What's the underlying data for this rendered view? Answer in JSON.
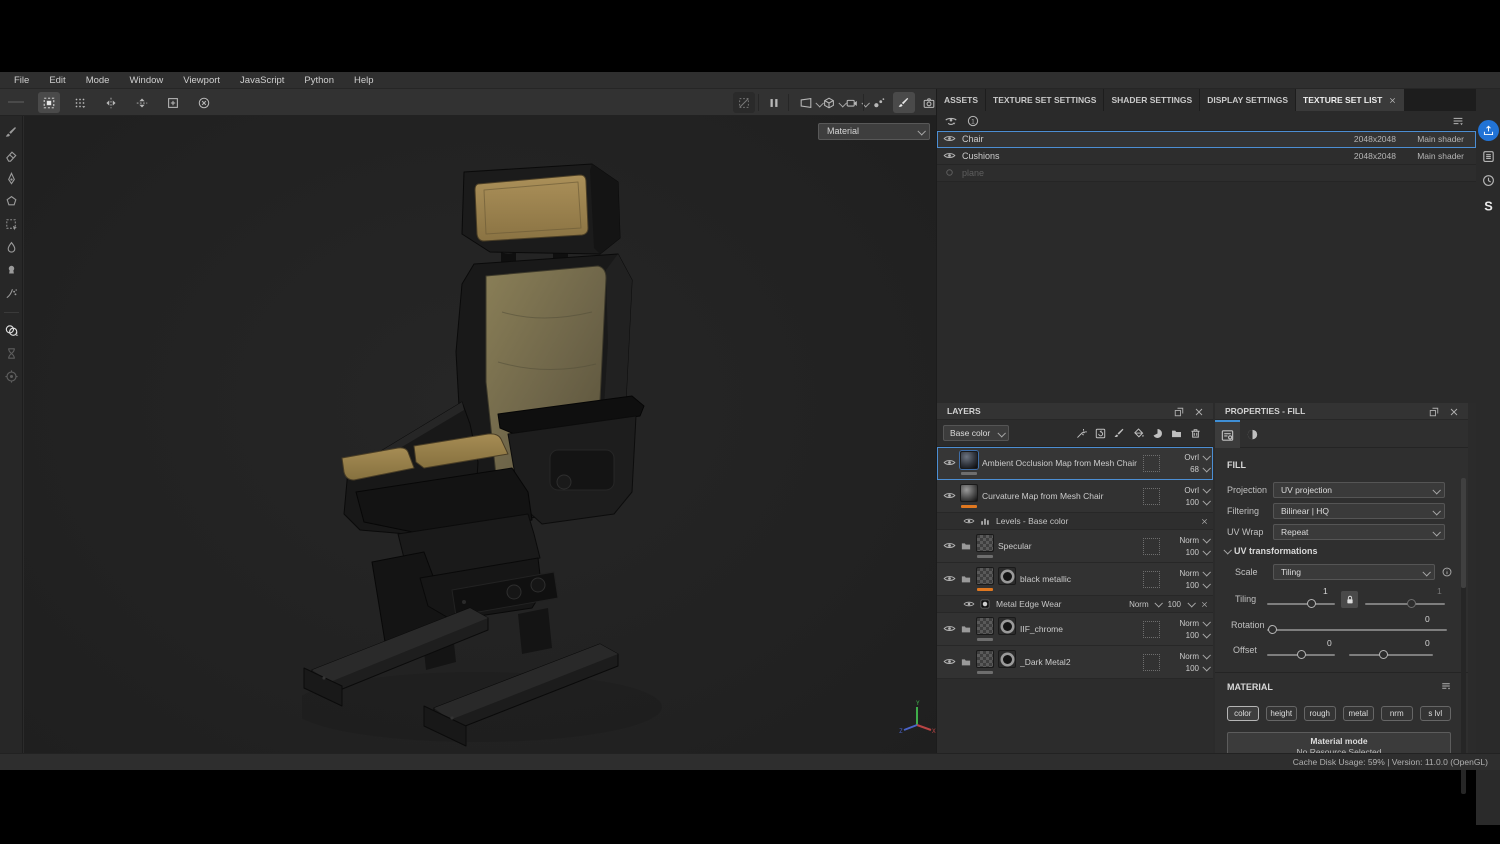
{
  "menu": {
    "items": [
      "File",
      "Edit",
      "Mode",
      "Window",
      "Viewport",
      "JavaScript",
      "Python",
      "Help"
    ]
  },
  "toolbar": {
    "left_icons": [
      "marquee",
      "dot-grid",
      "symmetry-horizontal",
      "symmetry-vertical",
      "frame-add",
      "reset-circle"
    ],
    "left_active": "marquee",
    "viewport_icons": [
      "wireframe-disabled",
      "pause",
      "display-mode",
      "geometry-mode",
      "camera-projection",
      "particles",
      "paint-brush",
      "screenshot"
    ],
    "viewport_active": "paint-brush"
  },
  "tools_sidebar": {
    "icons": [
      "brush-tool",
      "eraser-tool",
      "projection-tool",
      "polygon-fill-tool",
      "selection-tool",
      "smudge-tool",
      "clone-tool",
      "particle-tool"
    ],
    "lower_icons": [
      "material-picker-tool",
      "hourglass-tool",
      "bake-tool"
    ]
  },
  "viewport": {
    "material_selector": "Material",
    "gizmo": {
      "x": "X",
      "y": "Y",
      "z": "Z"
    }
  },
  "tabs": {
    "items": [
      {
        "label": "ASSETS",
        "active": false
      },
      {
        "label": "TEXTURE SET SETTINGS",
        "active": false
      },
      {
        "label": "SHADER SETTINGS",
        "active": false
      },
      {
        "label": "DISPLAY SETTINGS",
        "active": false
      },
      {
        "label": "TEXTURE SET LIST",
        "active": true,
        "closable": true
      }
    ]
  },
  "texture_set_list": {
    "header_icons": [
      "toggle-all-visibility",
      "solo-view"
    ],
    "options_icon": "options-menu",
    "rows": [
      {
        "name": "Chair",
        "resolution": "2048x2048",
        "shader": "Main shader",
        "state": "selected"
      },
      {
        "name": "Cushions",
        "resolution": "2048x2048",
        "shader": "Main shader",
        "state": "normal"
      },
      {
        "name": "plane",
        "resolution": "",
        "shader": "",
        "state": "disabled"
      }
    ]
  },
  "layers_panel": {
    "title": "LAYERS",
    "channel_filter": "Base color",
    "toolbar_icons": [
      "add-effect",
      "add-fill-layer",
      "add-paint-layer",
      "add-fill",
      "add-smart-material",
      "add-group",
      "delete-layer"
    ],
    "items": [
      {
        "name": "Ambient Occlusion Map from Mesh Chair",
        "blend": "Ovrl",
        "opacity": "68",
        "kind": "fill",
        "thumb": "dark",
        "bar": "gray",
        "selected": true
      },
      {
        "name": "Curvature Map from Mesh Chair",
        "blend": "Ovrl",
        "opacity": "100",
        "kind": "fill",
        "thumb": "sphere",
        "bar": "orange",
        "selected": false
      },
      {
        "name": "Levels - Base color",
        "kind": "effect",
        "selected": false
      },
      {
        "name": "Specular",
        "blend": "Norm",
        "opacity": "100",
        "kind": "group",
        "bar": "gray",
        "selected": false
      },
      {
        "name": "black metallic",
        "blend": "Norm",
        "opacity": "100",
        "kind": "group-mask",
        "bar": "orange",
        "selected": false
      },
      {
        "name": "Metal Edge Wear",
        "blend": "Norm",
        "opacity": "100",
        "kind": "effect-mask",
        "selected": false
      },
      {
        "name": "IIF_chrome",
        "blend": "Norm",
        "opacity": "100",
        "kind": "group-mask",
        "bar": "gray",
        "selected": false
      },
      {
        "name": "_Dark Metal2",
        "blend": "Norm",
        "opacity": "100",
        "kind": "group-mask",
        "bar": "gray",
        "selected": false
      }
    ]
  },
  "properties": {
    "title": "PROPERTIES - FILL",
    "tabs": [
      "fill-settings",
      "material-sphere"
    ],
    "section": "FILL",
    "rows": [
      {
        "label": "Projection",
        "value": "UV projection"
      },
      {
        "label": "Filtering",
        "value": "Bilinear | HQ"
      },
      {
        "label": "UV Wrap",
        "value": "Repeat"
      }
    ],
    "uv": {
      "title": "UV transformations",
      "scale_label": "Scale",
      "scale_value": "Tiling",
      "tiling_label": "Tiling",
      "tiling_x": "1",
      "tiling_y": "1",
      "rotation_label": "Rotation",
      "rotation_value": "0",
      "offset_label": "Offset",
      "offset_x": "0",
      "offset_y": "0"
    },
    "material": {
      "title": "MATERIAL",
      "channels": [
        "color",
        "height",
        "rough",
        "metal",
        "nrm",
        "s lvl"
      ],
      "selected_channel": "color",
      "mode_title": "Material mode",
      "mode_subtitle": "No Resource Selected"
    }
  },
  "dock": {
    "icons": [
      "export",
      "texture-log",
      "history",
      "substance"
    ]
  },
  "status_bar": {
    "text": "Cache Disk Usage:   59% | Version: 11.0.0 (OpenGL)"
  },
  "colors": {
    "accent_blue": "#4c8ed3",
    "export_blue": "#2173d6",
    "accent_orange": "#e07820",
    "panel_bg": "#2f2f2f",
    "viewport_bg": "#232323"
  }
}
